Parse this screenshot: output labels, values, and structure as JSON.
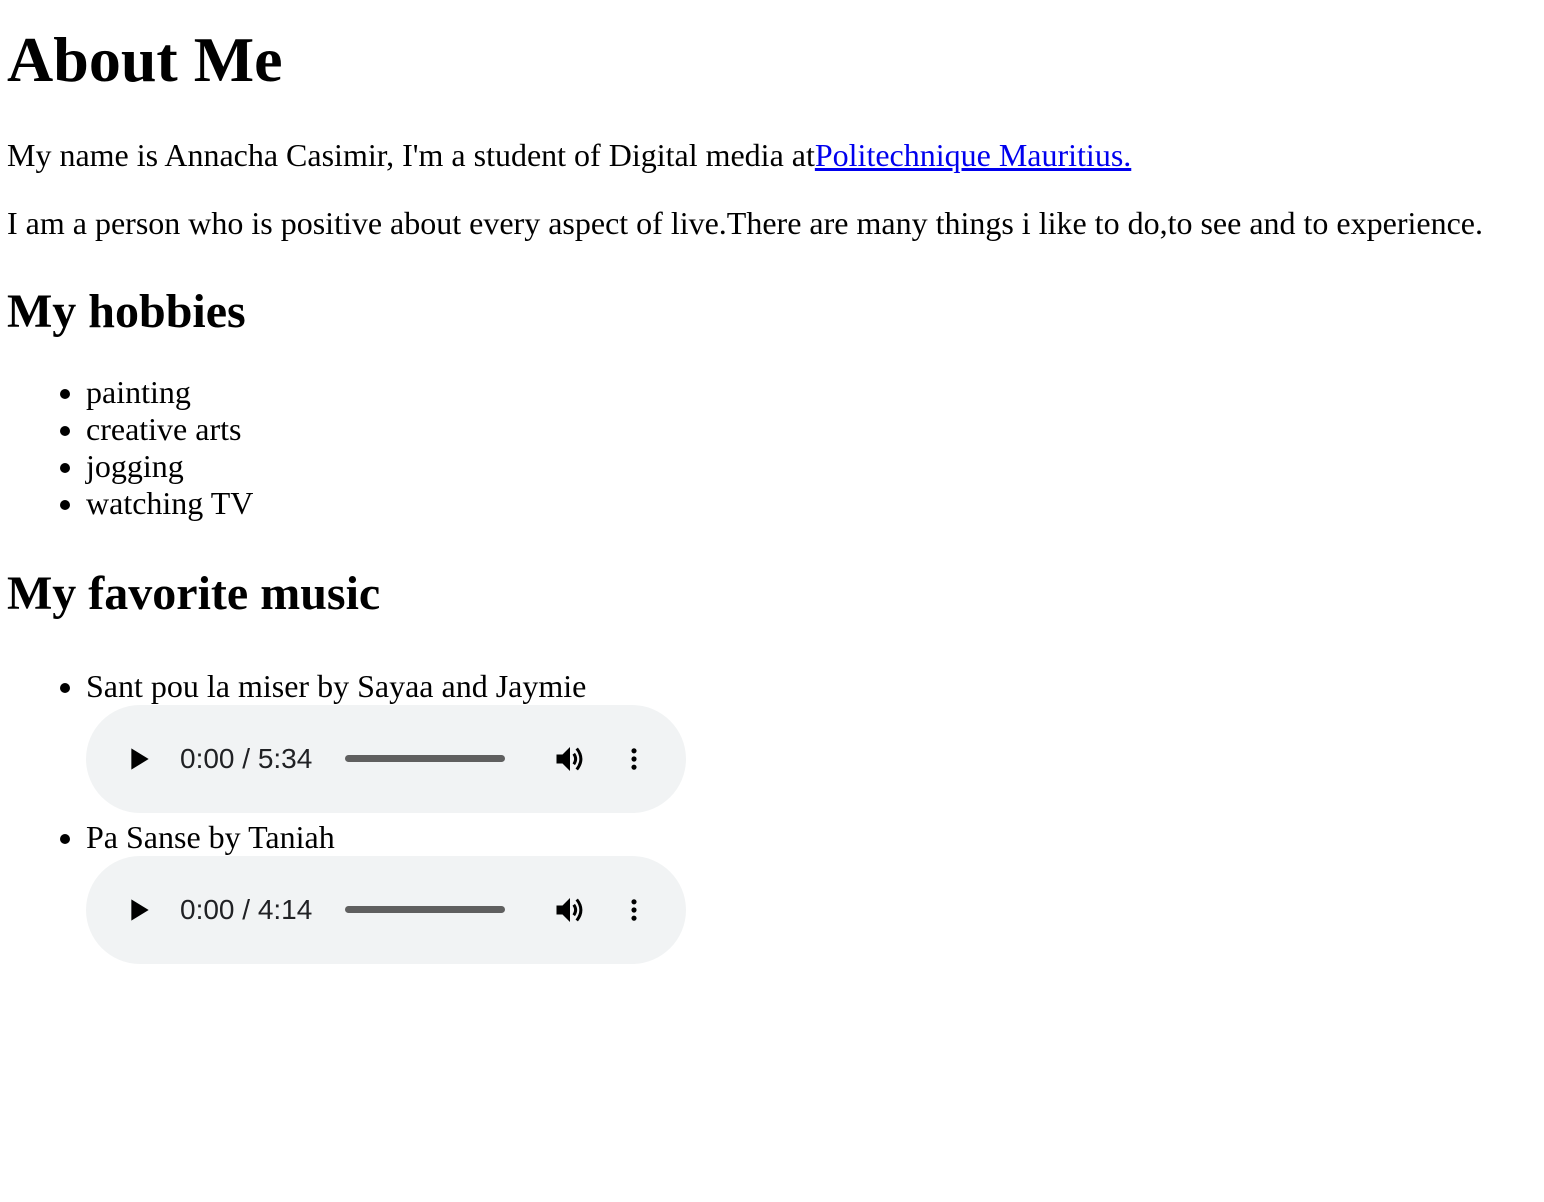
{
  "page": {
    "title": "About Me",
    "intro_text": "My name is Annacha Casimir, I'm a student of Digital media at",
    "intro_link": "Politechnique Mauritius.",
    "description": "I am a person who is positive about every aspect of live.There are many things i like to do,to see and to experience."
  },
  "hobbies": {
    "heading": "My hobbies",
    "items": [
      "painting",
      "creative arts",
      "jogging",
      "watching TV"
    ]
  },
  "music": {
    "heading": "My favorite music",
    "tracks": [
      {
        "label": "Sant pou la miser by Sayaa and Jaymie",
        "time": "0:00 / 5:34",
        "progress": 0
      },
      {
        "label": "Pa Sanse by Taniah",
        "time": "0:00 / 4:14",
        "progress": 0
      }
    ]
  },
  "icons": {
    "play": "play-icon",
    "volume": "volume-icon",
    "menu": "more-vertical-icon"
  },
  "colors": {
    "link": "#0000ee",
    "player_bg": "#f1f3f4"
  }
}
